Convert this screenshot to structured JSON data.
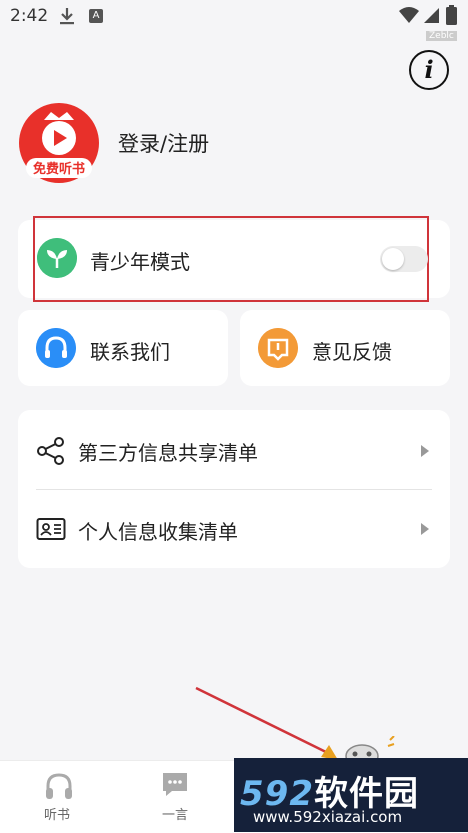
{
  "status_bar": {
    "time": "2:42",
    "a_badge": "A",
    "corner_badge": "Zeblc"
  },
  "info_button": {
    "glyph": "i"
  },
  "profile": {
    "avatar_text": "免费听书",
    "login_label": "登录/注册"
  },
  "teen_mode": {
    "label": "青少年模式",
    "enabled": false
  },
  "quick_actions": {
    "contact_label": "联系我们",
    "feedback_label": "意见反馈"
  },
  "lists": {
    "share_label": "第三方信息共享清单",
    "personal_label": "个人信息收集清单"
  },
  "bottom_nav": {
    "listen_label": "听书",
    "quote_label": "一言"
  },
  "watermark": {
    "logo_digits": "592",
    "logo_text": "软件园",
    "url": "www.592xiazai.com"
  },
  "colors": {
    "teen_icon": "#3fbe7b",
    "contact_icon": "#2a8ef7",
    "feedback_icon": "#f39a37",
    "highlight": "#d0343a",
    "avatar_red": "#e8302a"
  }
}
